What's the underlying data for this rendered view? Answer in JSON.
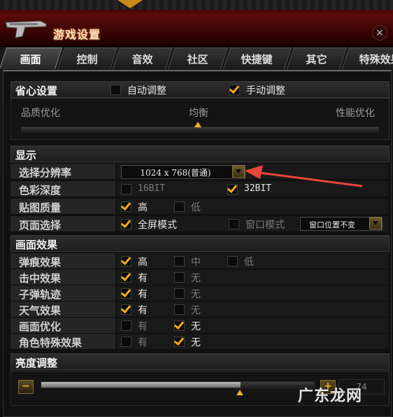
{
  "header": {
    "title": "游戏设置",
    "close_icon": "×"
  },
  "tabs": [
    {
      "label": "画面",
      "active": true
    },
    {
      "label": "控制"
    },
    {
      "label": "音效"
    },
    {
      "label": "社区"
    },
    {
      "label": "快捷键"
    },
    {
      "label": "其它"
    },
    {
      "label": "特殊效果"
    }
  ],
  "preset": {
    "label": "省心设置",
    "auto_label": "自动调整",
    "auto_checked": false,
    "manual_label": "手动调整",
    "manual_checked": true,
    "quality_label": "品质优化",
    "balance_label": "均衡",
    "performance_label": "性能优化"
  },
  "display": {
    "section_label": "显示",
    "resolution": {
      "label": "选择分辨率",
      "value": "1024 x 768(普通)"
    },
    "color_depth": {
      "label": "色彩深度",
      "opt1": "16BIT",
      "opt1_checked": false,
      "opt2": "32BIT",
      "opt2_checked": true
    },
    "texture": {
      "label": "贴图质量",
      "opt1": "高",
      "opt1_checked": true,
      "opt2": "低",
      "opt2_checked": false
    },
    "page_mode": {
      "label": "页面选择",
      "opt1": "全屏模式",
      "opt1_checked": true,
      "opt2": "窗口模式",
      "opt2_checked": false,
      "window_select": "窗口位置不变"
    }
  },
  "effects": {
    "section_label": "画面效果",
    "rows": [
      {
        "label": "弹痕效果",
        "opts": [
          "高",
          "中",
          "低"
        ],
        "checked": [
          true,
          false,
          false
        ]
      },
      {
        "label": "击中效果",
        "opts": [
          "有",
          "无"
        ],
        "checked": [
          true,
          false
        ]
      },
      {
        "label": "子弹轨迹",
        "opts": [
          "有",
          "无"
        ],
        "checked": [
          true,
          false
        ]
      },
      {
        "label": "天气效果",
        "opts": [
          "有",
          "无"
        ],
        "checked": [
          true,
          false
        ]
      },
      {
        "label": "画面优化",
        "opts": [
          "有",
          "无"
        ],
        "checked": [
          false,
          true
        ]
      },
      {
        "label": "角色特殊效果",
        "opts": [
          "有",
          "无"
        ],
        "checked": [
          false,
          true
        ]
      }
    ]
  },
  "brightness": {
    "section_label": "亮度调整",
    "minus": "−",
    "plus": "+",
    "value": "74",
    "level": 0.73
  },
  "watermark": "广东龙网",
  "colors": {
    "accent": "#f2b21a",
    "arrow": "#e8463a"
  }
}
